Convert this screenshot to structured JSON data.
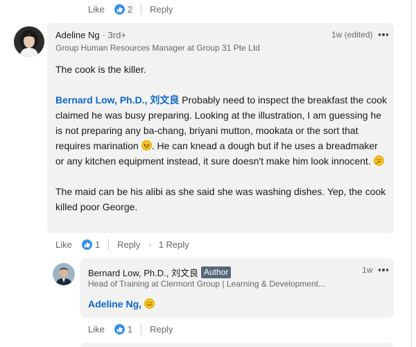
{
  "top_actions": {
    "like": "Like",
    "reaction_count": "2",
    "reply": "Reply"
  },
  "comment_main": {
    "author_name": "Adeline Ng",
    "degree": "· 3rd+",
    "headline": "Group Human Resources Manager at Group 31 Pte Ltd",
    "time": "1w (edited)",
    "line1": "The cook is the killer.",
    "mention": "Bernard Low, Ph.D., 刘文良",
    "para2_a": " Probably need to inspect the breakfast the cook claimed he was busy preparing. Looking at the illustration, I am guessing he is not preparing any ba-chang, briyani mutton, mookata or the sort that requires marination ",
    "para2_b": ". He can knead a dough but if he uses a breadmaker or any kitchen equipment instead, it sure doesn't make him look innocent. ",
    "para3": "The maid can be his alibi as she said she was washing dishes. Yep, the cook killed poor George."
  },
  "main_actions": {
    "like": "Like",
    "reaction_count": "1",
    "reply": "Reply",
    "replies_count": "1 Reply"
  },
  "comment_reply": {
    "author_name": "Bernard Low, Ph.D., 刘文良",
    "badge": "Author",
    "headline": "Head of Training at Clermont Group | Learning & Development...",
    "time": "1w",
    "mention": "Adeline Ng,"
  },
  "reply_actions": {
    "like": "Like",
    "reaction_count": "1",
    "reply": "Reply"
  },
  "colors": {
    "link": "#0a66c2",
    "bubble": "#f2f2f2",
    "reaction": "#378fe9"
  },
  "icons": [
    "like-reaction-icon",
    "more-options-icon",
    "laughing-emoji-icon",
    "thinking-emoji-icon",
    "smile-emoji-icon"
  ]
}
